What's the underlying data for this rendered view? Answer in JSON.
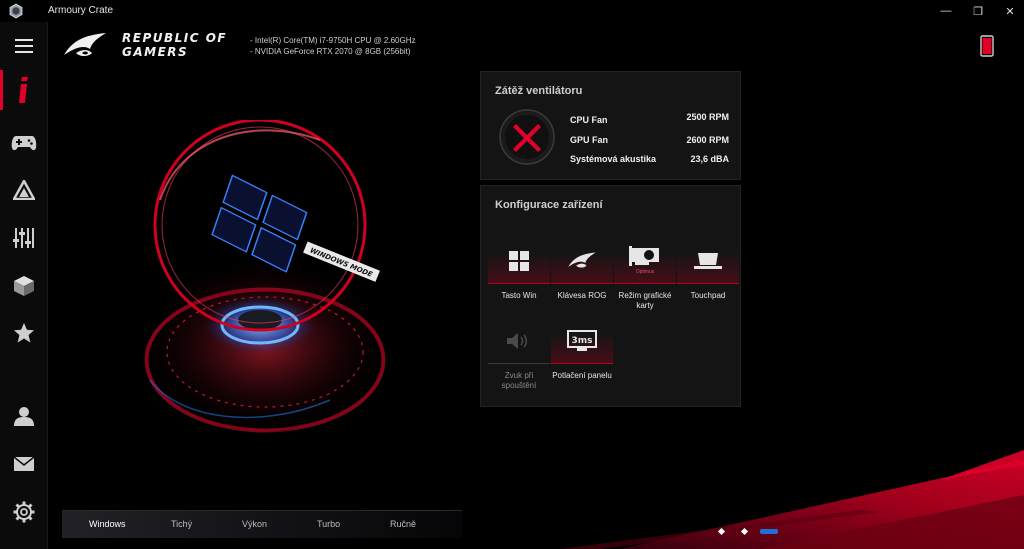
{
  "window": {
    "title": "Armoury Crate",
    "controls": [
      "—",
      "❐",
      "✕"
    ]
  },
  "header": {
    "wordmark_line1": "REPUBLIC OF",
    "wordmark_line2": "GAMERS",
    "specs": [
      "-  Intel(R) Core(TM) i7-9750H CPU @ 2.60GHz",
      "-  NVIDIA GeForce RTX 2070 @ 8GB (256bit)"
    ]
  },
  "hero": {
    "mode_label": "WINDOWS MODE"
  },
  "fan_panel": {
    "title": "Zátěž ventilátoru",
    "rows": [
      {
        "label": "CPU Fan",
        "value": "2500  RPM"
      },
      {
        "label": "GPU Fan",
        "value": "2600  RPM"
      },
      {
        "label": "Systémová akustika",
        "value": "23,6  dBA"
      }
    ]
  },
  "config_panel": {
    "title": "Konfigurace zařízení",
    "tiles": [
      {
        "label": "Tasto Win",
        "icon": "windows-key-icon",
        "enabled": true
      },
      {
        "label": "Klávesa ROG",
        "icon": "rog-key-icon",
        "enabled": true
      },
      {
        "label": "Režim grafické karty",
        "icon": "graphics-card-icon",
        "enabled": true,
        "badge": "Optimus"
      },
      {
        "label": "Touchpad",
        "icon": "touchpad-icon",
        "enabled": true
      },
      {
        "label": "Zvuk při spouštění",
        "icon": "boot-sound-icon",
        "enabled": false
      },
      {
        "label": "Potlačení panelu",
        "icon": "panel-overdrive-icon",
        "enabled": true,
        "badge": "3ms"
      }
    ]
  },
  "modes": {
    "items": [
      "Windows",
      "Tichý",
      "Výkon",
      "Turbo",
      "Ručně"
    ],
    "active": "Windows"
  },
  "colors": {
    "accent": "#e0002a",
    "page_indicator": "#1e6fd8"
  }
}
